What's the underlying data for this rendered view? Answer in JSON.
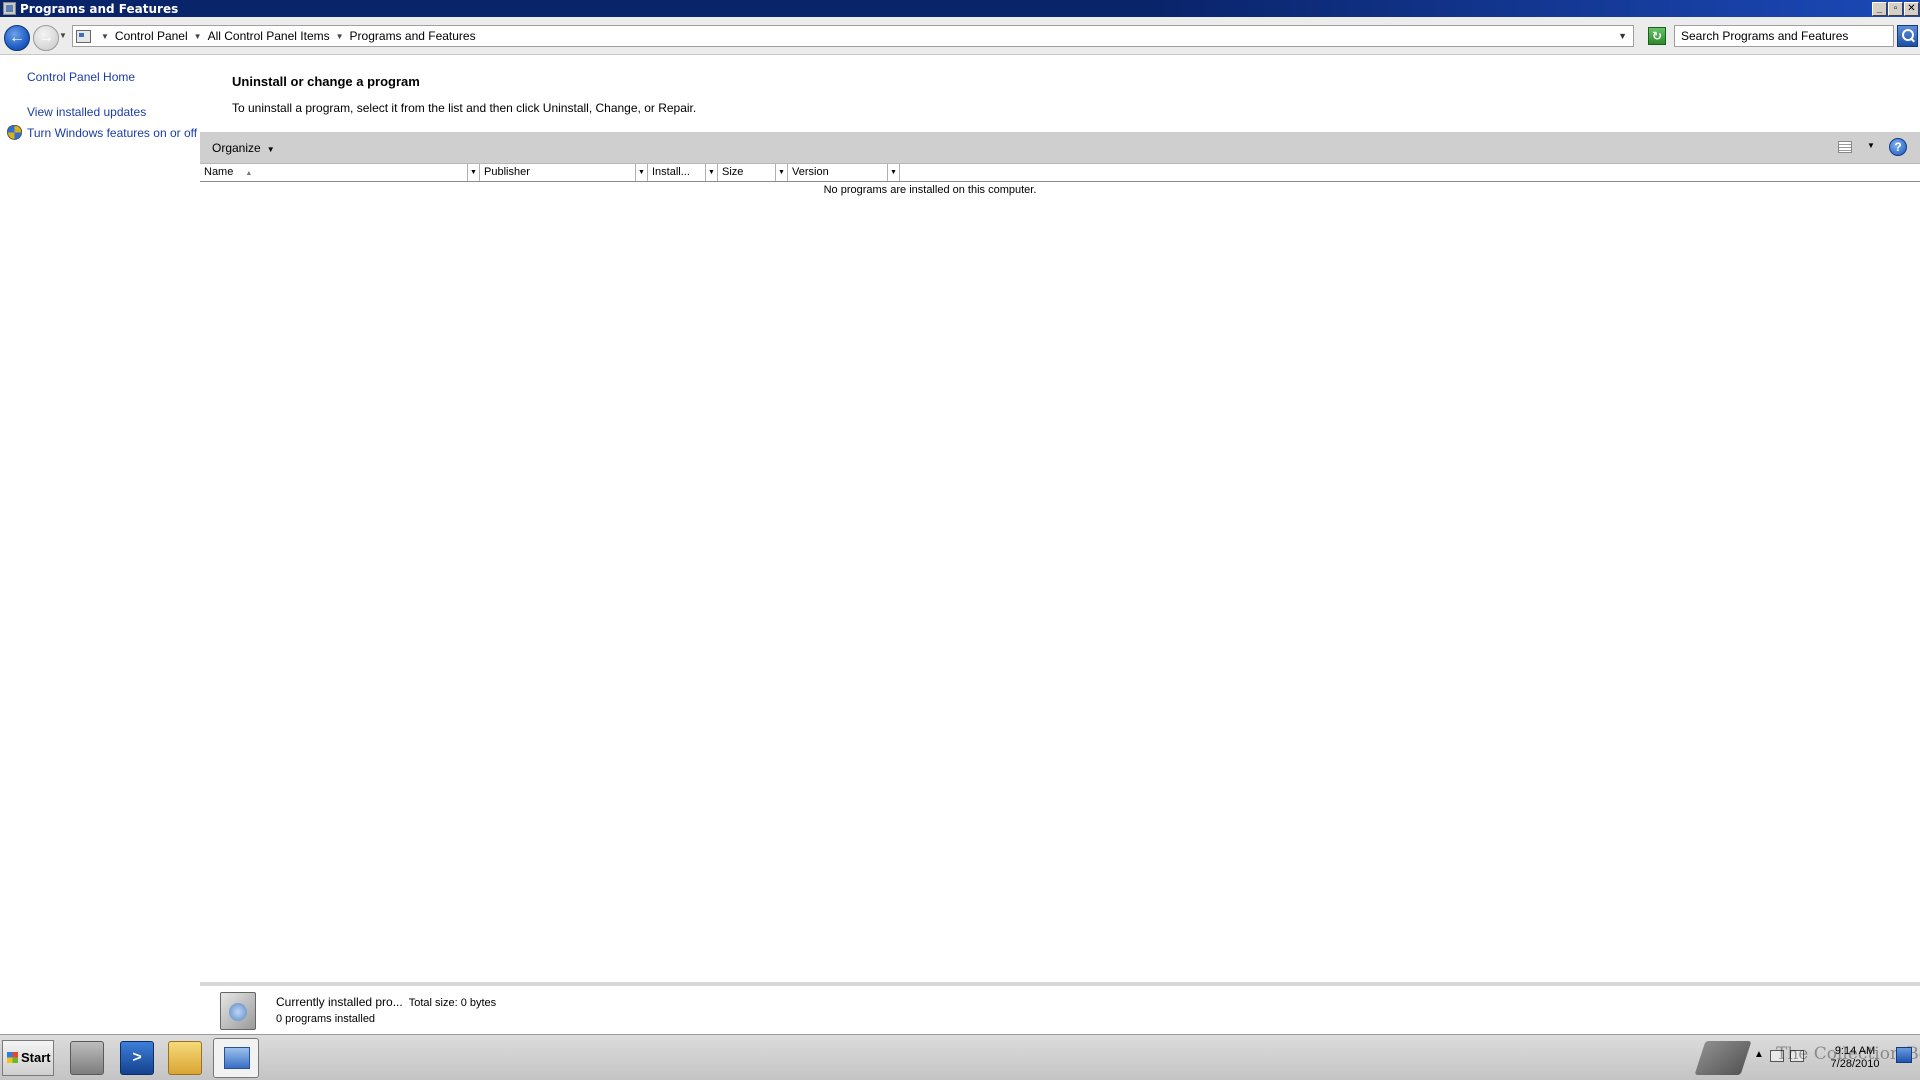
{
  "window": {
    "title": "Programs and Features",
    "minimize": "_",
    "restore": "▫",
    "close": "✕"
  },
  "address": {
    "back_glyph": "←",
    "forward_glyph": "→",
    "crumbs": [
      "Control Panel",
      "All Control Panel Items",
      "Programs and Features"
    ],
    "search_placeholder": "Search Programs and Features"
  },
  "sidebar": {
    "items": [
      {
        "label": "Control Panel Home"
      },
      {
        "label": "View installed updates"
      },
      {
        "label": "Turn Windows features on or off",
        "icon": "shield-icon"
      }
    ]
  },
  "main": {
    "title": "Uninstall or change a program",
    "description": "To uninstall a program, select it from the list and then click Uninstall, Change, or Repair.",
    "toolbar": {
      "organize_label": "Organize",
      "help_glyph": "?"
    },
    "columns": [
      "Name",
      "Publisher",
      "Install...",
      "Size",
      "Version"
    ],
    "empty_message": "No programs are installed on this computer."
  },
  "details": {
    "line1": "Currently installed pro...",
    "total_size": "Total size: 0 bytes",
    "line2": "0 programs installed"
  },
  "taskbar": {
    "start_label": "Start",
    "powershell_glyph": ">",
    "watermark": "The Collection Book",
    "time": "9:14 AM",
    "date": "7/28/2010"
  }
}
